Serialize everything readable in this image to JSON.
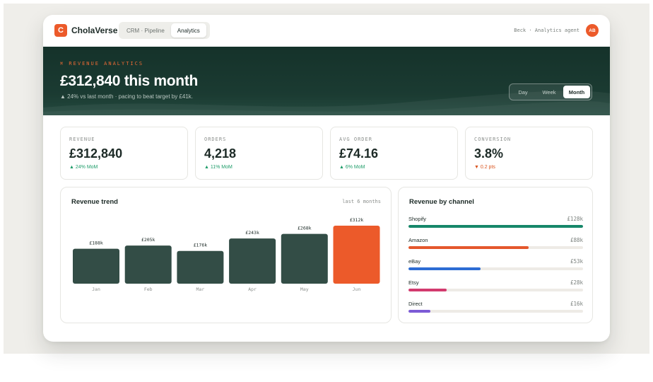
{
  "app": {
    "brand": "CholaVerse",
    "logo_letter": "C"
  },
  "tabs": [
    {
      "label": "CRM · Pipeline",
      "active": false
    },
    {
      "label": "Analytics",
      "active": true
    }
  ],
  "agent_label": "Beck · Analytics agent",
  "avatar_initials": "AB",
  "hero": {
    "eyebrow": "⌘ REVENUE ANALYTICS",
    "title": "£312,840 this month",
    "subtitle": "▲ 24% vs last month · pacing to beat target by £41k."
  },
  "range": {
    "options": [
      "Day",
      "Week",
      "Month"
    ],
    "selected": "Month"
  },
  "kpis": [
    {
      "label": "REVENUE",
      "value": "£312,840",
      "delta": "▲ 24% MoM",
      "trend": "up"
    },
    {
      "label": "ORDERS",
      "value": "4,218",
      "delta": "▲ 11% MoM",
      "trend": "up"
    },
    {
      "label": "AVG ORDER",
      "value": "£74.16",
      "delta": "▲ 6% MoM",
      "trend": "up"
    },
    {
      "label": "CONVERSION",
      "value": "3.8%",
      "delta": "▼ 0.2 pts",
      "trend": "down"
    }
  ],
  "trend_panel": {
    "title": "Revenue trend",
    "meta": "last 6 months"
  },
  "channels_panel": {
    "title": "Revenue by channel"
  },
  "channels": [
    {
      "name": "Shopify",
      "value": "£128k",
      "amount": 128,
      "color": "#16876a"
    },
    {
      "name": "Amazon",
      "value": "£88k",
      "amount": 88,
      "color": "#e4572c"
    },
    {
      "name": "eBay",
      "value": "£53k",
      "amount": 53,
      "color": "#2d6cd4"
    },
    {
      "name": "Etsy",
      "value": "£28k",
      "amount": 28,
      "color": "#d23a6e"
    },
    {
      "name": "Direct",
      "value": "£16k",
      "amount": 16,
      "color": "#7c5bd6"
    }
  ],
  "colors": {
    "accent": "#ec5a2a",
    "bar": "#334d46",
    "bar_highlight": "#ec5a2a",
    "hero_bg": "#15322a"
  },
  "chart_data": {
    "type": "bar",
    "title": "Revenue trend",
    "categories": [
      "Jan",
      "Feb",
      "Mar",
      "Apr",
      "May",
      "Jun"
    ],
    "values": [
      188,
      205,
      176,
      243,
      268,
      312
    ],
    "data_labels": [
      "£188k",
      "£205k",
      "£176k",
      "£243k",
      "£268k",
      "£312k"
    ],
    "highlight": "Jun",
    "unit": "£k"
  }
}
